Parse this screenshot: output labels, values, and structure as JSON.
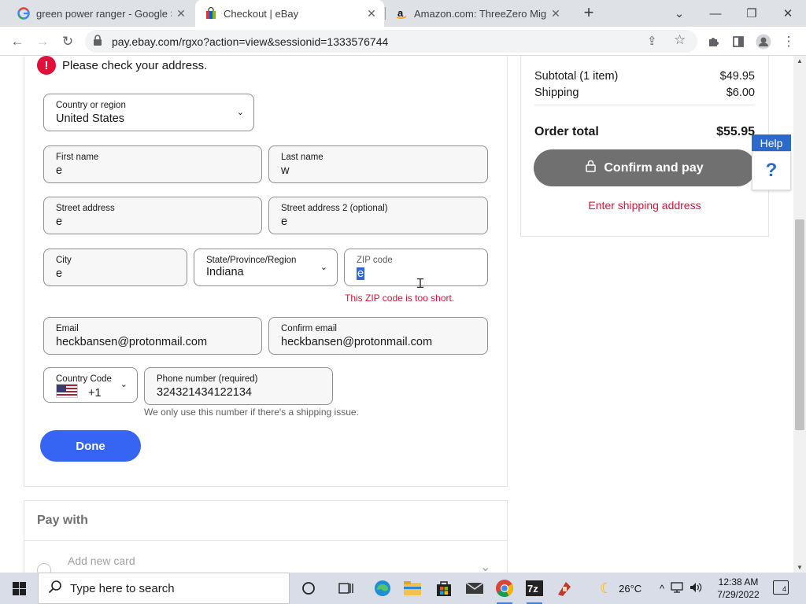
{
  "browser": {
    "tabs": [
      {
        "title": "green power ranger - Google Se",
        "favicon": "google-g-icon"
      },
      {
        "title": "Checkout | eBay",
        "favicon": "ebay-bag-icon",
        "active": true
      },
      {
        "title": "Amazon.com: ThreeZero Mighty",
        "favicon": "amazon-a-icon"
      }
    ],
    "url": "pay.ebay.com/rgxo?action=view&sessionid=1333576744"
  },
  "address_form": {
    "alert": "Please check your address.",
    "country": {
      "label": "Country or region",
      "value": "United States"
    },
    "first_name": {
      "label": "First name",
      "value": "e"
    },
    "last_name": {
      "label": "Last name",
      "value": "w"
    },
    "street1": {
      "label": "Street address",
      "value": "e"
    },
    "street2": {
      "label": "Street address 2 (optional)",
      "value": "e"
    },
    "city": {
      "label": "City",
      "value": "e"
    },
    "state": {
      "label": "State/Province/Region",
      "value": "Indiana"
    },
    "zip": {
      "label": "ZIP code",
      "value": "e",
      "error": "This ZIP code is too short."
    },
    "email": {
      "label": "Email",
      "value": "heckbansen@protonmail.com"
    },
    "confirm_email": {
      "label": "Confirm email",
      "value": "heckbansen@protonmail.com"
    },
    "country_code": {
      "label": "Country Code",
      "value": "+1"
    },
    "phone": {
      "label": "Phone number (required)",
      "value": "324321434122134",
      "help": "We only use this number if there's a shipping issue."
    },
    "done_label": "Done"
  },
  "pay_with": {
    "title": "Pay with",
    "add_card": "Add new card"
  },
  "summary": {
    "subtotal_label": "Subtotal (1 item)",
    "subtotal_value": "$49.95",
    "shipping_label": "Shipping",
    "shipping_value": "$6.00",
    "total_label": "Order total",
    "total_value": "$55.95",
    "confirm_label": "Confirm and pay",
    "warning": "Enter shipping address"
  },
  "help": {
    "tab_label": "Help",
    "icon_label": "?"
  },
  "taskbar": {
    "search_placeholder": "Type here to search",
    "weather": "26°C",
    "time": "12:38 AM",
    "date": "7/29/2022",
    "notifications": "4"
  },
  "colors": {
    "primary_blue": "#3665f3",
    "error_red": "#e0103a",
    "disabled_gray": "#707070"
  }
}
